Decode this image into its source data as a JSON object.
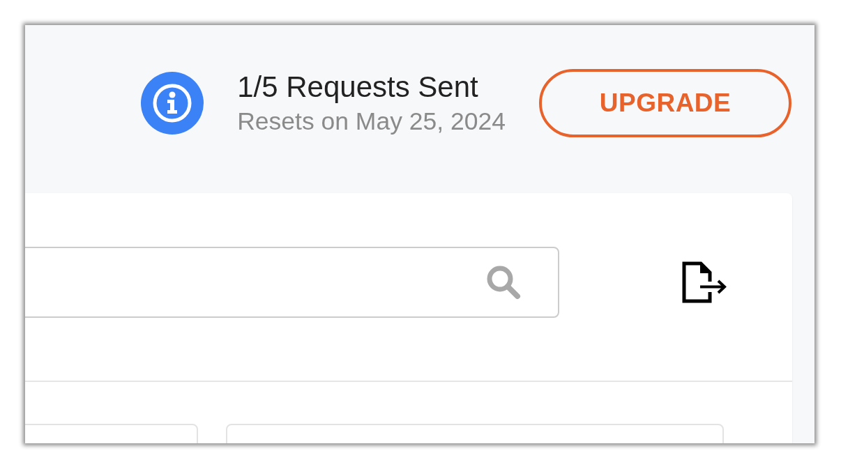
{
  "usage": {
    "title": "1/5 Requests Sent",
    "subtitle": "Resets on May 25, 2024"
  },
  "upgrade_button": {
    "label": "UPGRADE"
  }
}
